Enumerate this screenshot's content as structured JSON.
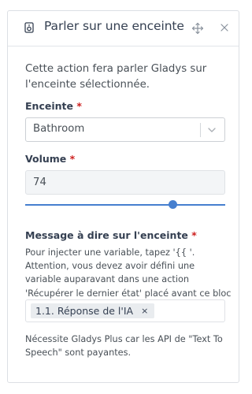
{
  "header": {
    "title": "Parler sur une enceinte",
    "icons": {
      "action": "speaker-icon",
      "move": "move-icon",
      "close": "close-icon"
    }
  },
  "description": "Cette action fera parler Gladys sur l'enceinte sélectionnée.",
  "speaker_field": {
    "label": "Enceinte",
    "required_mark": "*",
    "selected": "Bathroom"
  },
  "volume_field": {
    "label": "Volume",
    "required_mark": "*",
    "value": "74",
    "slider_level_percent": 74
  },
  "message_field": {
    "label": "Message à dire sur l'enceinte",
    "required_mark": "*",
    "help": "Pour injecter une variable, tapez '{{ '. Attention, vous devez avoir défini une variable auparavant dans une action 'Récupérer le dernier état' placé avant ce bloc message.",
    "tags": [
      {
        "label": "1.1. Réponse de l'IA",
        "remove": "×"
      }
    ]
  },
  "footer_note": "Nécessite Gladys Plus car les API de \"Text To Speech\" sont payantes.",
  "colors": {
    "accent": "#467fcf",
    "required": "#cd201f",
    "text": "#495057"
  }
}
